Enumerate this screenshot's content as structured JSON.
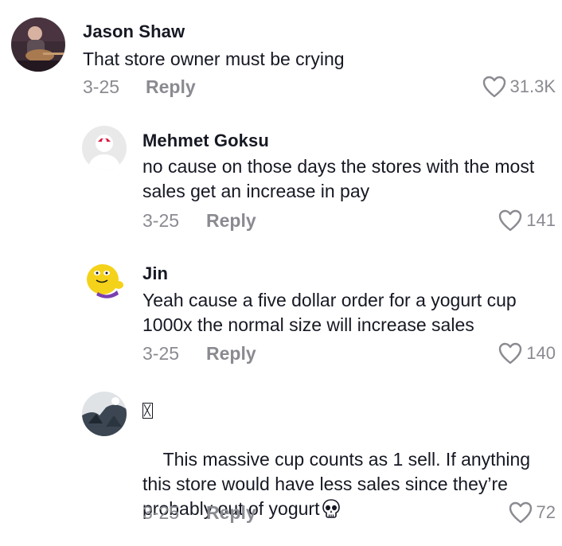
{
  "comments": [
    {
      "username": "Jason Shaw",
      "text": "That store owner must be crying",
      "date": "3-25",
      "reply_label": "Reply",
      "likes": "31.3K",
      "avatar": "guitar-player-photo"
    },
    {
      "username": "Mehmet Goksu",
      "text": "no cause on those days the stores with the most sales get an increase in pay",
      "date": "3-25",
      "reply_label": "Reply",
      "likes": "141",
      "avatar": "default-user-avatar"
    },
    {
      "username": "Jin",
      "text": "Yeah cause a five dollar order for a yogurt cup 1000x the normal size will increase sales",
      "date": "3-25",
      "reply_label": "Reply",
      "likes": "140",
      "avatar": "yellow-candy-character"
    },
    {
      "username": "▯",
      "text_part1": "This massive cup counts as 1 sell. If anything this store would have less sales since they’re probably out of yogurt",
      "emoji": "skull-emoji",
      "date": "3-25",
      "reply_label": "Reply",
      "likes": "72",
      "avatar": "dark-photo"
    }
  ],
  "colors": {
    "text": "#161823",
    "secondary": "#8a8b91"
  }
}
